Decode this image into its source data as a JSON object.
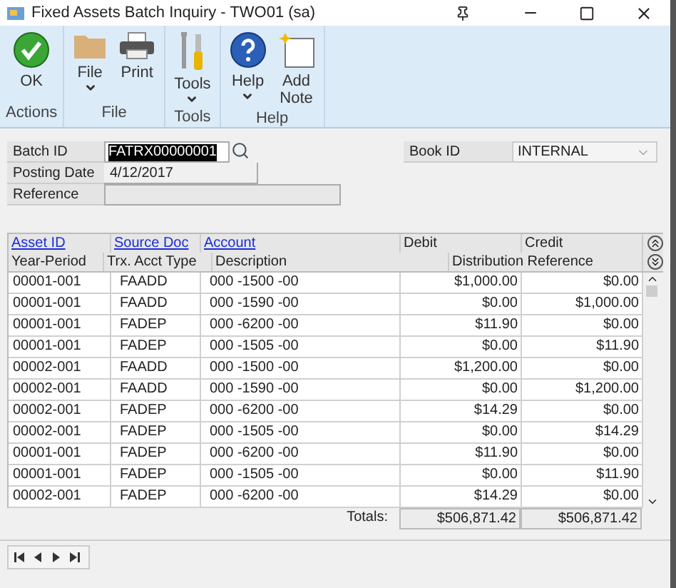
{
  "window": {
    "title": "Fixed Assets Batch Inquiry  -  TWO01 (sa)"
  },
  "ribbon": [
    {
      "label": "Actions",
      "buttons": [
        {
          "label": "OK",
          "kind": "ok",
          "has_menu": false
        }
      ]
    },
    {
      "label": "File",
      "buttons": [
        {
          "label": "File",
          "kind": "folder",
          "has_menu": true
        },
        {
          "label": "Print",
          "kind": "printer",
          "has_menu": false
        }
      ]
    },
    {
      "label": "Tools",
      "buttons": [
        {
          "label": "Tools",
          "kind": "tools",
          "has_menu": true
        }
      ]
    },
    {
      "label": "Help",
      "buttons": [
        {
          "label": "Help",
          "kind": "help",
          "has_menu": true
        },
        {
          "label": "Add\nNote",
          "kind": "note",
          "has_menu": false
        }
      ]
    }
  ],
  "form": {
    "batch_id": {
      "label": "Batch ID",
      "value": "FATRX00000001"
    },
    "posting_date": {
      "label": "Posting Date",
      "value": "4/12/2017"
    },
    "reference": {
      "label": "Reference"
    },
    "book_id": {
      "label": "Book ID",
      "value": "INTERNAL"
    }
  },
  "grid": {
    "header_1": [
      {
        "label": "Asset ID",
        "kind": "link"
      },
      {
        "label": "Source Doc",
        "kind": "link"
      },
      {
        "label": "Account",
        "kind": "link"
      },
      {
        "label": "Debit",
        "kind": "plain"
      },
      {
        "label": "Credit",
        "kind": "plain"
      }
    ],
    "header_2": [
      "Year-Period",
      "Trx. Acct Type",
      "Description",
      "Distribution Reference"
    ],
    "rows": [
      [
        "00001-001",
        "FAADD",
        "000 -1500 -00",
        "$1,000.00",
        "$0.00"
      ],
      [
        "00001-001",
        "FAADD",
        "000 -1590 -00",
        "$0.00",
        "$1,000.00"
      ],
      [
        "00001-001",
        "FADEP",
        "000 -6200 -00",
        "$11.90",
        "$0.00"
      ],
      [
        "00001-001",
        "FADEP",
        "000 -1505 -00",
        "$0.00",
        "$11.90"
      ],
      [
        "00002-001",
        "FAADD",
        "000 -1500 -00",
        "$1,200.00",
        "$0.00"
      ],
      [
        "00002-001",
        "FAADD",
        "000 -1590 -00",
        "$0.00",
        "$1,200.00"
      ],
      [
        "00002-001",
        "FADEP",
        "000 -6200 -00",
        "$14.29",
        "$0.00"
      ],
      [
        "00002-001",
        "FADEP",
        "000 -1505 -00",
        "$0.00",
        "$14.29"
      ],
      [
        "00001-001",
        "FADEP",
        "000 -6200 -00",
        "$11.90",
        "$0.00"
      ],
      [
        "00001-001",
        "FADEP",
        "000 -1505 -00",
        "$0.00",
        "$11.90"
      ],
      [
        "00002-001",
        "FADEP",
        "000 -6200 -00",
        "$14.29",
        "$0.00"
      ]
    ],
    "totals": {
      "label": "Totals:",
      "debit": "$506,871.42",
      "credit": "$506,871.42"
    }
  }
}
